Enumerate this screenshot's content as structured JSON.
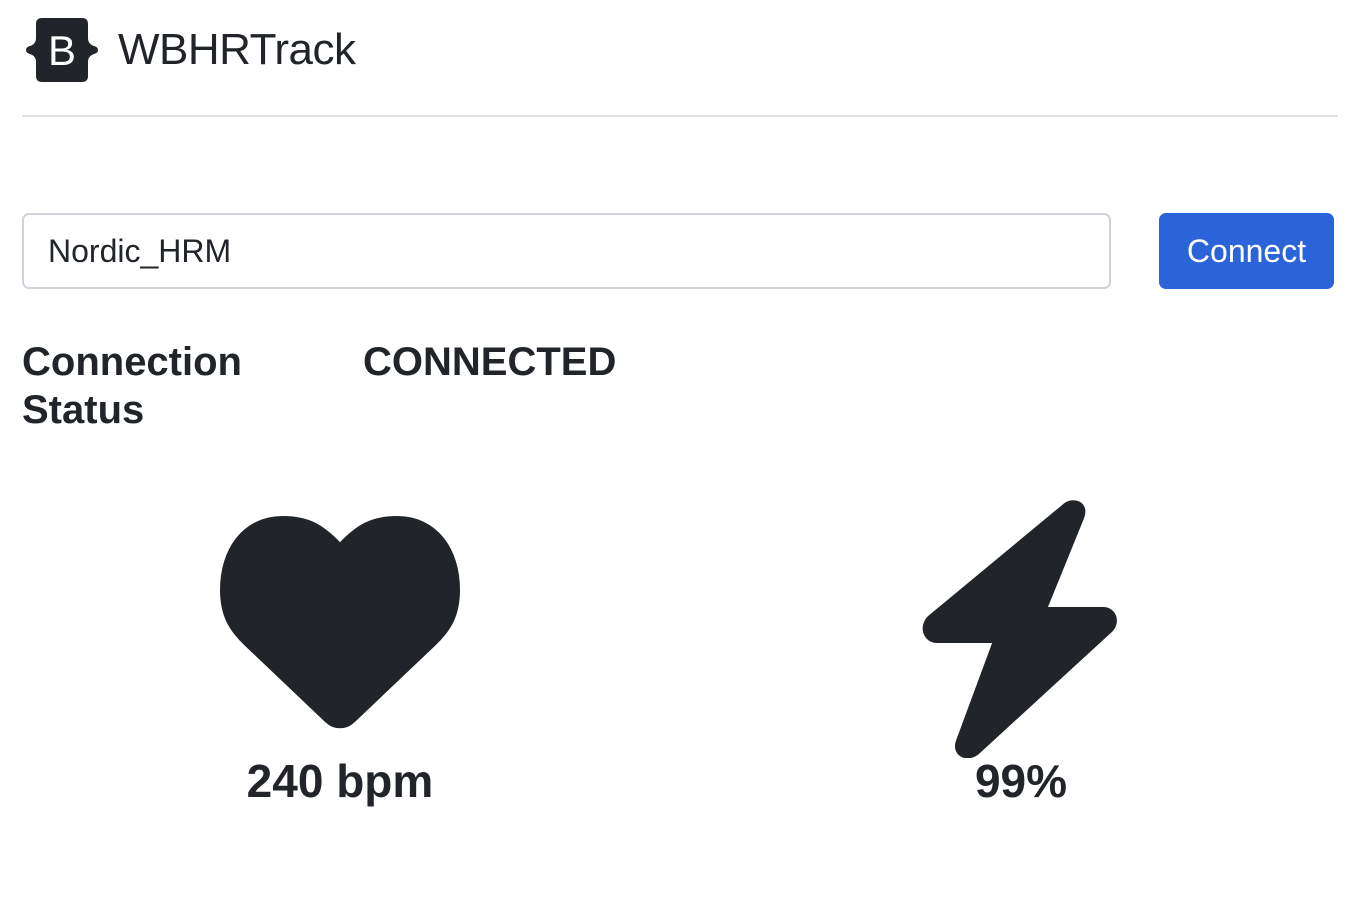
{
  "header": {
    "logo_icon": "bootstrap-logo-icon",
    "logo_letter": "B",
    "title": "WBHRTrack"
  },
  "device": {
    "input_value": "Nordic_HRM",
    "connect_label": "Connect"
  },
  "status": {
    "label": "Connection Status",
    "value": "CONNECTED"
  },
  "metrics": {
    "heart_rate": {
      "icon": "heart-icon",
      "value": "240 bpm"
    },
    "battery": {
      "icon": "lightning-icon",
      "value": "99%"
    }
  },
  "colors": {
    "text": "#212529",
    "accent": "#2b63d9",
    "border": "#ced4da",
    "divider": "#dee2e6"
  }
}
